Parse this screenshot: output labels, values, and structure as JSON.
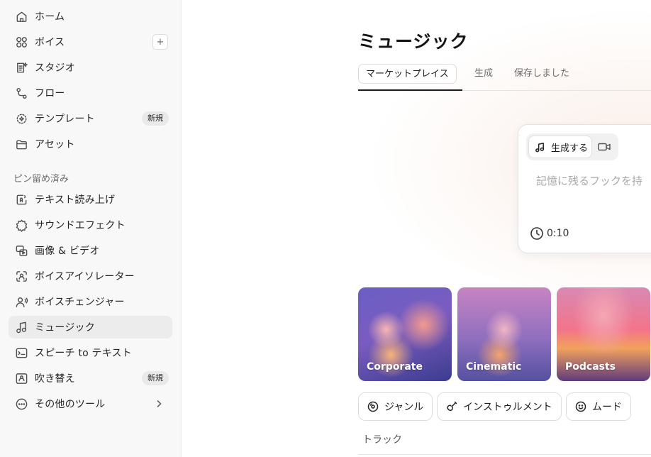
{
  "sidebar": {
    "items": [
      {
        "label": "ホーム"
      },
      {
        "label": "ボイス",
        "action": "+"
      },
      {
        "label": "スタジオ"
      },
      {
        "label": "フロー"
      },
      {
        "label": "テンプレート",
        "badge": "新規"
      },
      {
        "label": "アセット"
      }
    ],
    "pinned_label": "ピン留め済み",
    "pinned": [
      {
        "label": "テキスト読み上げ"
      },
      {
        "label": "サウンドエフェクト"
      },
      {
        "label": "画像 & ビデオ"
      },
      {
        "label": "ボイスアイソレーター"
      },
      {
        "label": "ボイスチェンジャー"
      },
      {
        "label": "ミュージック",
        "active": true
      },
      {
        "label": "スピーチ to テキスト"
      },
      {
        "label": "吹き替え",
        "badge": "新規"
      },
      {
        "label": "その他のツール"
      }
    ]
  },
  "main": {
    "title": "ミュージック",
    "tabs": [
      {
        "label": "マーケットプレイス",
        "active": true
      },
      {
        "label": "生成"
      },
      {
        "label": "保存しました"
      }
    ],
    "generator": {
      "mode_label": "生成する",
      "prompt_placeholder": "記憶に残るフックを持",
      "duration": "0:10"
    },
    "genres": [
      {
        "label": "Corporate"
      },
      {
        "label": "Cinematic"
      },
      {
        "label": "Podcasts"
      }
    ],
    "filters": [
      {
        "label": "ジャンル",
        "icon": "disc-icon"
      },
      {
        "label": "インストゥルメント",
        "icon": "guitar-icon"
      },
      {
        "label": "ムード",
        "icon": "smile-icon"
      }
    ],
    "tracks_label": "トラック"
  }
}
